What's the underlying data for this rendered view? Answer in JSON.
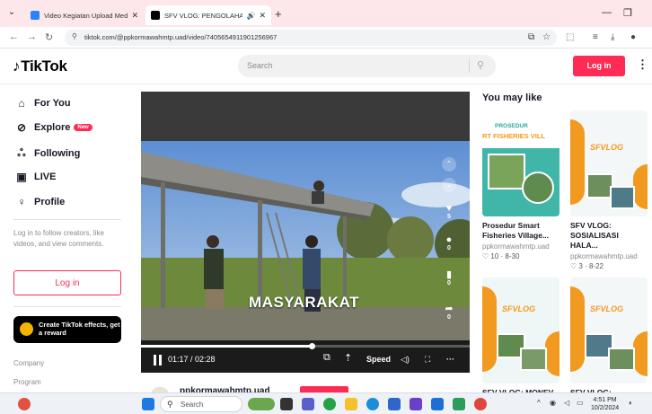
{
  "browser": {
    "tabs": [
      {
        "title": "Video Kegiatan Upload Media"
      },
      {
        "title": "SFV VLOG: PENGOLAHAN"
      }
    ],
    "url": "tiktok.com/@ppkormawahmtp.uad/video/7405654911901256967"
  },
  "header": {
    "logo": "TikTok",
    "search_placeholder": "Search",
    "login_label": "Log in"
  },
  "sidebar": {
    "items": [
      {
        "label": "For You",
        "icon": "home-icon"
      },
      {
        "label": "Explore",
        "icon": "compass-icon",
        "badge": "New"
      },
      {
        "label": "Following",
        "icon": "people-icon"
      },
      {
        "label": "LIVE",
        "icon": "live-icon"
      },
      {
        "label": "Profile",
        "icon": "person-icon"
      }
    ],
    "hint": "Log in to follow creators, like videos, and view comments.",
    "login_label": "Log in",
    "effects_label": "Create TikTok effects, get a reward",
    "footer": [
      "Company",
      "Program"
    ]
  },
  "video": {
    "caption": "MASYARAKAT",
    "time": "01:17 / 02:28",
    "speed_label": "Speed",
    "progress": 0.52,
    "actions": [
      {
        "name": "like",
        "count": "5"
      },
      {
        "name": "comment",
        "count": "0"
      },
      {
        "name": "save",
        "count": "0"
      },
      {
        "name": "share",
        "count": "0"
      }
    ],
    "author": "ppkormawahmtp.uad"
  },
  "you_may_like": {
    "title": "You may like",
    "cards": [
      {
        "title": "Prosedur Smart Fisheries Village...",
        "author": "ppkormawahmtp.uad",
        "views": "10",
        "date": "8-30",
        "thumb_text": "PROSEDUR",
        "thumb_sub": "RT FISHERIES VILL"
      },
      {
        "title": "SFV VLOG: SOSIALISASI HALA...",
        "author": "ppkormawahmtp.uad",
        "views": "3",
        "date": "8-22",
        "thumb_text": "SFVLOG"
      },
      {
        "title": "SFV VLOG: MONEV",
        "thumb_text": "SFVLOG"
      },
      {
        "title": "SFV VLOG:",
        "thumb_text": "SFVLOG"
      }
    ]
  },
  "taskbar": {
    "search_label": "Search",
    "time": "4:51 PM",
    "date": "10/2/2024"
  },
  "colors": {
    "accent": "#fe2c55",
    "thumb_teal": "#3fb6a8",
    "thumb_orange": "#f29a1f"
  }
}
